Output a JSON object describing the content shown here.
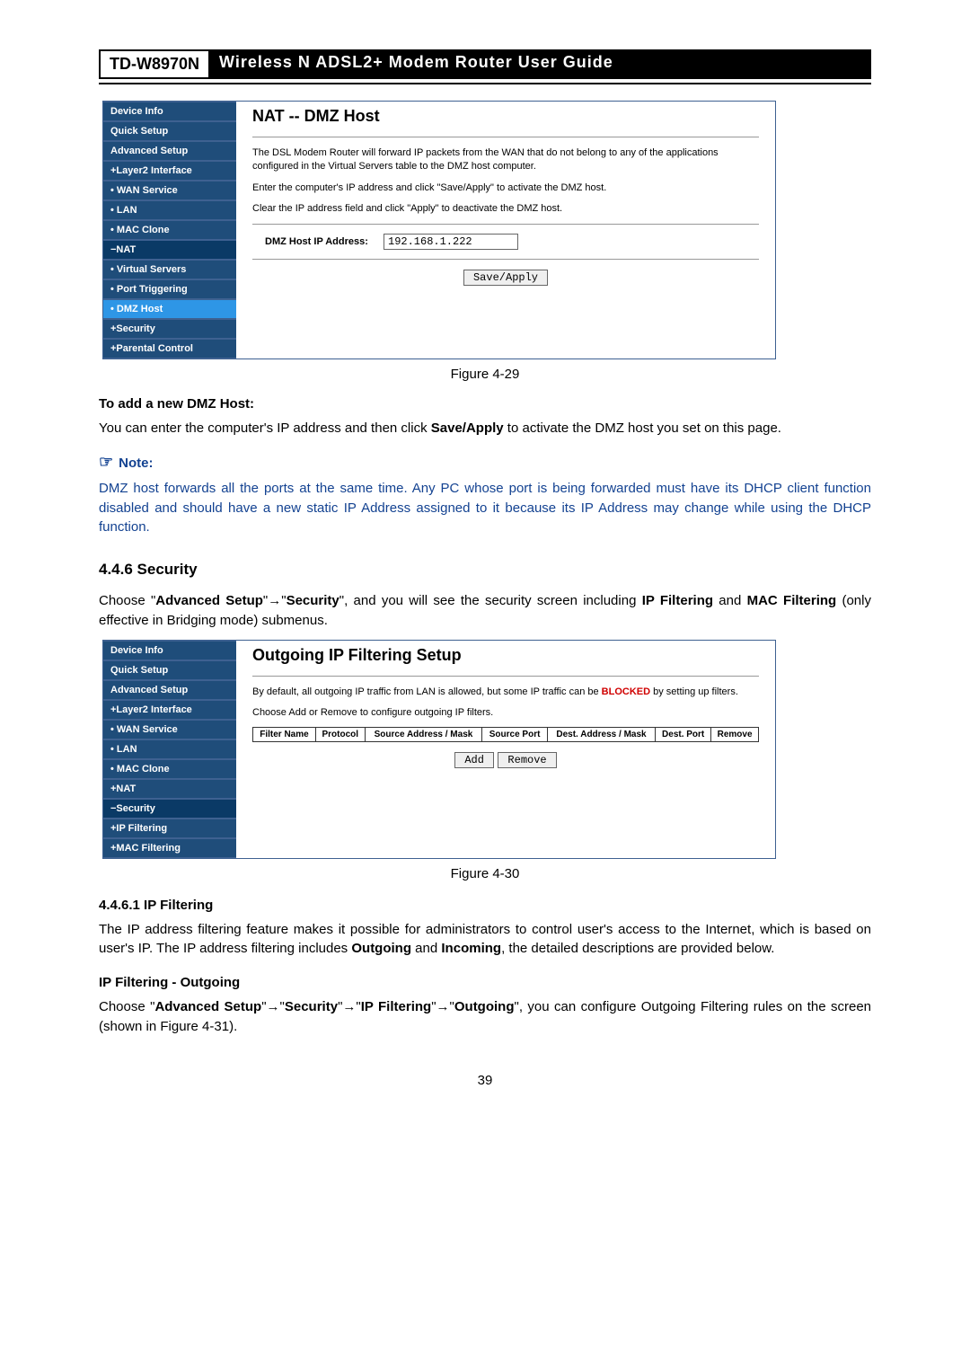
{
  "header": {
    "model": "TD-W8970N",
    "title": "Wireless  N  ADSL2+  Modem  Router  User  Guide"
  },
  "fig1": {
    "nav": [
      {
        "label": "Device Info",
        "cls": ""
      },
      {
        "label": "Quick Setup",
        "cls": ""
      },
      {
        "label": "Advanced Setup",
        "cls": ""
      },
      {
        "label": "+Layer2 Interface",
        "cls": "sub"
      },
      {
        "label": "• WAN Service",
        "cls": "sub"
      },
      {
        "label": "• LAN",
        "cls": "sub"
      },
      {
        "label": "• MAC Clone",
        "cls": "sub"
      },
      {
        "label": "−NAT",
        "cls": "sub expanded"
      },
      {
        "label": "• Virtual Servers",
        "cls": "sub"
      },
      {
        "label": "• Port Triggering",
        "cls": "sub"
      },
      {
        "label": "• DMZ Host",
        "cls": "sub active"
      },
      {
        "label": "+Security",
        "cls": "sub"
      },
      {
        "label": "+Parental Control",
        "cls": "sub"
      }
    ],
    "title": "NAT -- DMZ Host",
    "p1": "The DSL Modem Router will forward IP packets from the WAN that do not belong to any of the applications configured in the Virtual Servers table to the DMZ host computer.",
    "p2": "Enter the computer's IP address and click \"Save/Apply\" to activate the DMZ host.",
    "p3": "Clear the IP address field and click \"Apply\" to deactivate the DMZ host.",
    "field_label": "DMZ Host IP Address:",
    "field_value": "192.168.1.222",
    "button": "Save/Apply",
    "caption": "Figure 4-29"
  },
  "bodytext": {
    "add_h": "To add a new DMZ Host:",
    "add_p": "You can enter the computer's IP address and then click ",
    "add_p_bold": "Save/Apply",
    "add_p_tail": " to activate the DMZ host you set on this page.",
    "note_label": "Note:",
    "note_body": "DMZ host forwards all the ports at the same time. Any PC whose port is being forwarded must have its DHCP client function disabled and should have a new static IP Address assigned to it because its IP Address may change while using the DHCP function.",
    "sec": "4.4.6   Security",
    "sec_p_pre": "Choose  \"",
    "sec_p_b1": "Advanced  Setup",
    "sec_arrow": "→",
    "sec_p_b2": "Security",
    "sec_p_mid": "\",  and  you  will  see  the  security  screen  including  ",
    "sec_p_b3": "IP Filtering",
    "sec_p_and": " and ",
    "sec_p_b4": "MAC Filtering",
    "sec_p_tail": " (only effective in Bridging mode) submenus.",
    "ipf_h": "4.4.6.1   IP Filtering",
    "ipf_p_pre": "The IP address filtering feature makes it possible for administrators to control user's access to the Internet, which is based on user's IP. The IP address filtering includes ",
    "ipf_b1": "Outgoing",
    "ipf_and": " and ",
    "ipf_b2": "Incoming",
    "ipf_tail": ", the detailed descriptions are provided below.",
    "out_h": "IP Filtering - Outgoing",
    "out_p_pre": "Choose   \"",
    "out_b1": "Advanced   Setup",
    "out_b2": "Security",
    "out_b3": "IP   Filtering",
    "out_b4": "Outgoing",
    "out_tail": "\",   you   can   configure Outgoing Filtering rules on the screen (shown in Figure 4-31)."
  },
  "fig2": {
    "nav": [
      {
        "label": "Device Info",
        "cls": ""
      },
      {
        "label": "Quick Setup",
        "cls": ""
      },
      {
        "label": "Advanced Setup",
        "cls": ""
      },
      {
        "label": "+Layer2 Interface",
        "cls": "sub"
      },
      {
        "label": "• WAN Service",
        "cls": "sub"
      },
      {
        "label": "• LAN",
        "cls": "sub"
      },
      {
        "label": "• MAC Clone",
        "cls": "sub"
      },
      {
        "label": "+NAT",
        "cls": "sub"
      },
      {
        "label": "−Security",
        "cls": "sub expanded"
      },
      {
        "label": "+IP Filtering",
        "cls": "sub"
      },
      {
        "label": "+MAC Filtering",
        "cls": "sub"
      }
    ],
    "title": "Outgoing IP Filtering Setup",
    "p1a": "By default, all outgoing IP traffic from LAN is allowed, but some IP traffic can be ",
    "p1red": "BLOCKED",
    "p1b": " by setting up filters.",
    "p2": "Choose Add or Remove to configure outgoing IP filters.",
    "cols": [
      "Filter Name",
      "Protocol",
      "Source Address / Mask",
      "Source Port",
      "Dest. Address / Mask",
      "Dest. Port",
      "Remove"
    ],
    "btn_add": "Add",
    "btn_remove": "Remove",
    "caption": "Figure 4-30"
  },
  "pagenum": "39"
}
